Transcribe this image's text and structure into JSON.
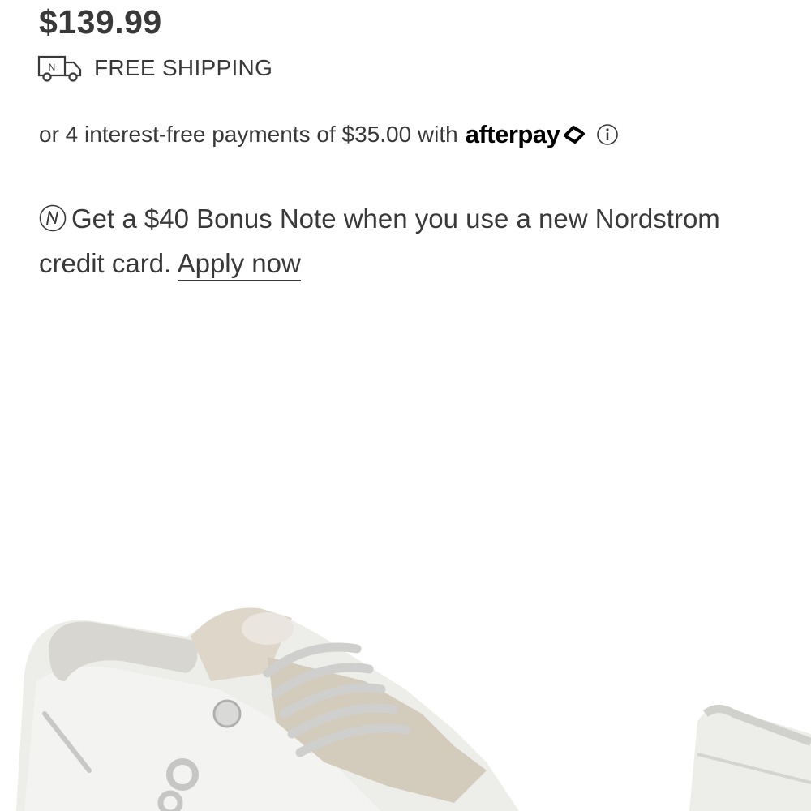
{
  "product": {
    "price": "$139.99",
    "shipping_label": "FREE SHIPPING",
    "shipping_icon": "delivery-truck-icon"
  },
  "afterpay": {
    "text": "or 4 interest-free payments of $35.00 with",
    "brand": "afterpay",
    "brand_icon": "afterpay-arrows-icon",
    "info_icon": "info-icon"
  },
  "bonus": {
    "icon": "nordstrom-n-icon",
    "text": "Get a $40 Bonus Note when you use a new Nordstrom credit card.",
    "link_label": "Apply now"
  },
  "image": {
    "content": "white sneakers product photo"
  },
  "colors": {
    "text": "#393939",
    "brand_black": "#000000",
    "background": "#ffffff"
  }
}
